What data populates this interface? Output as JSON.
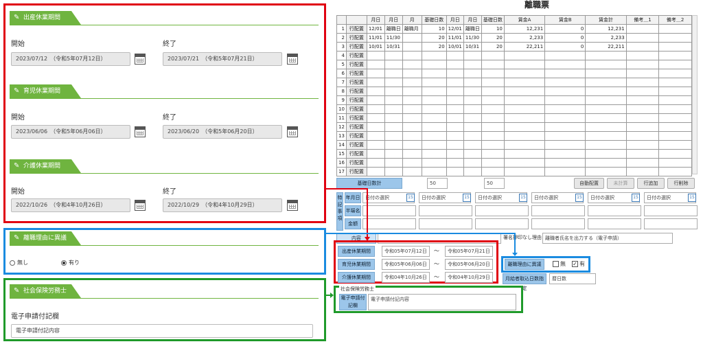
{
  "left": {
    "maternity": {
      "title": "出産休業期間",
      "start_label": "開始",
      "end_label": "終了",
      "start_value": "2023/07/12　（令和5年07月12日）",
      "end_value": "2023/07/21　（令和5年07月21日）"
    },
    "childcare": {
      "title": "育児休業期間",
      "start_label": "開始",
      "end_label": "終了",
      "start_value": "2023/06/06　（令和5年06月06日）",
      "end_value": "2023/06/20　（令和5年06月20日）"
    },
    "nursing": {
      "title": "介護休業期間",
      "start_label": "開始",
      "end_label": "終了",
      "start_value": "2022/10/26　（令和4年10月26日）",
      "end_value": "2022/10/29　（令和4年10月29日）"
    },
    "objection": {
      "title": "離職理由に異議",
      "none_label": "無し",
      "yes_label": "有り"
    },
    "sharoushi": {
      "title": "社会保険労務士",
      "field_label": "電子申請付記欄",
      "field_value": "電子申請付記内容"
    }
  },
  "right": {
    "title": "離職票",
    "headers": [
      "",
      "",
      "月日",
      "月日",
      "月",
      "基礎日数",
      "月日",
      "月日",
      "基礎日数",
      "賃金A",
      "賃金B",
      "賃金計",
      "備考＿1",
      "備考＿2"
    ],
    "rows": [
      [
        "1",
        "行配置",
        "12/01",
        "離職日",
        "離職月",
        "10",
        "12/01",
        "離職日",
        "10",
        "12,231",
        "0",
        "12,231",
        "",
        ""
      ],
      [
        "2",
        "行配置",
        "11/01",
        "11/30",
        "",
        "20",
        "11/01",
        "11/30",
        "20",
        "2,233",
        "0",
        "2,233",
        "",
        ""
      ],
      [
        "3",
        "行配置",
        "10/01",
        "10/31",
        "",
        "20",
        "10/01",
        "10/31",
        "20",
        "22,211",
        "0",
        "22,211",
        "",
        ""
      ],
      [
        "4",
        "行配置",
        "",
        "",
        "",
        "",
        "",
        "",
        "",
        "",
        "",
        "",
        "",
        ""
      ],
      [
        "5",
        "行配置",
        "",
        "",
        "",
        "",
        "",
        "",
        "",
        "",
        "",
        "",
        "",
        ""
      ],
      [
        "6",
        "行配置",
        "",
        "",
        "",
        "",
        "",
        "",
        "",
        "",
        "",
        "",
        "",
        ""
      ],
      [
        "7",
        "行配置",
        "",
        "",
        "",
        "",
        "",
        "",
        "",
        "",
        "",
        "",
        "",
        ""
      ],
      [
        "8",
        "行配置",
        "",
        "",
        "",
        "",
        "",
        "",
        "",
        "",
        "",
        "",
        "",
        ""
      ],
      [
        "9",
        "行配置",
        "",
        "",
        "",
        "",
        "",
        "",
        "",
        "",
        "",
        "",
        "",
        ""
      ],
      [
        "10",
        "行配置",
        "",
        "",
        "",
        "",
        "",
        "",
        "",
        "",
        "",
        "",
        "",
        ""
      ],
      [
        "11",
        "行配置",
        "",
        "",
        "",
        "",
        "",
        "",
        "",
        "",
        "",
        "",
        "",
        ""
      ],
      [
        "12",
        "行配置",
        "",
        "",
        "",
        "",
        "",
        "",
        "",
        "",
        "",
        "",
        "",
        ""
      ],
      [
        "13",
        "行配置",
        "",
        "",
        "",
        "",
        "",
        "",
        "",
        "",
        "",
        "",
        "",
        ""
      ],
      [
        "14",
        "行配置",
        "",
        "",
        "",
        "",
        "",
        "",
        "",
        "",
        "",
        "",
        "",
        ""
      ],
      [
        "15",
        "行配置",
        "",
        "",
        "",
        "",
        "",
        "",
        "",
        "",
        "",
        "",
        "",
        ""
      ],
      [
        "16",
        "行配置",
        "",
        "",
        "",
        "",
        "",
        "",
        "",
        "",
        "",
        "",
        "",
        ""
      ],
      [
        "17",
        "行配置",
        "",
        "",
        "",
        "",
        "",
        "",
        "",
        "",
        "",
        "",
        "",
        ""
      ]
    ],
    "basic_days_label": "基礎日数計",
    "basic_days_1": "50",
    "basic_days_2": "50",
    "btn_auto": "自動配置",
    "btn_calc": "未計算",
    "btn_add": "行追加",
    "btn_delete": "行削除",
    "special_label": "特記事項",
    "ym_label": "年月日",
    "pay_label": "半端名",
    "amount_label": "金額",
    "date_select": "日付の選択",
    "content_label": "内容",
    "sign_label": "署名押印なし理由",
    "sign_value": "離職者氏名を出力する（電子申請）",
    "maternity_btn": "出産休業期間",
    "maternity_from": "令和05年07月12日",
    "maternity_to": "令和05年07月21日",
    "childcare_btn": "育児休業期間",
    "childcare_from": "令和05年06月06日",
    "childcare_to": "令和05年06月20日",
    "nursing_btn": "介護休業期間",
    "nursing_from": "令和04年10月26日",
    "nursing_to": "令和04年10月29日",
    "tilde": "～",
    "objection_btn": "離職理由に異議",
    "obj_none": "無",
    "obj_yes": "有",
    "monthly_label": "月給者取込日数指定",
    "monthly_value": "暦日数",
    "sharoushi_group": "社会保険労務士",
    "e_apply_label": "電子申請付記欄",
    "e_apply_value": "電子申請付記内容"
  },
  "colors": {
    "red": "#e00010",
    "blue": "#1a8be0",
    "green": "#1f9a2a",
    "section": "#6fb43f"
  }
}
